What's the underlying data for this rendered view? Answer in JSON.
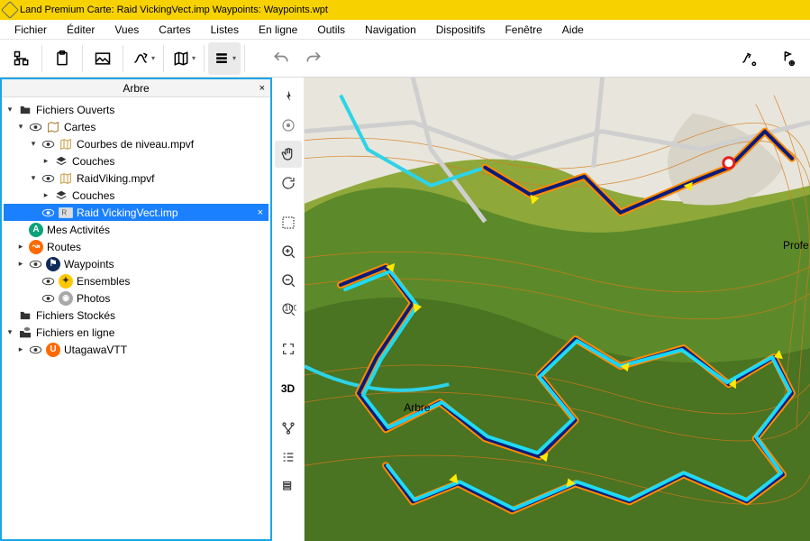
{
  "titlebar": {
    "text": "Land Premium Carte: Raid VickingVect.imp Waypoints:  Waypoints.wpt"
  },
  "menu": {
    "items": [
      "Fichier",
      "Éditer",
      "Vues",
      "Cartes",
      "Listes",
      "En ligne",
      "Outils",
      "Navigation",
      "Dispositifs",
      "Fenêtre",
      "Aide"
    ]
  },
  "sidebar": {
    "title": "Arbre",
    "close": "×"
  },
  "tree": {
    "open_files": "Fichiers Ouverts",
    "cartes": "Cartes",
    "courbes": "Courbes de niveau.mpvf",
    "couches": "Couches",
    "raidviking": "RaidViking.mpvf",
    "couches2": "Couches",
    "raidvect": "Raid VickingVect.imp",
    "activites": "Mes Activités",
    "routes": "Routes",
    "waypoints": "Waypoints",
    "ensembles": "Ensembles",
    "photos": "Photos",
    "stored": "Fichiers Stockés",
    "online": "Fichiers en ligne",
    "utagawa": "UtagawaVTT"
  },
  "map": {
    "label_arbre": "Arbre",
    "label_profe": "Profe",
    "btn_3d": "3D"
  }
}
